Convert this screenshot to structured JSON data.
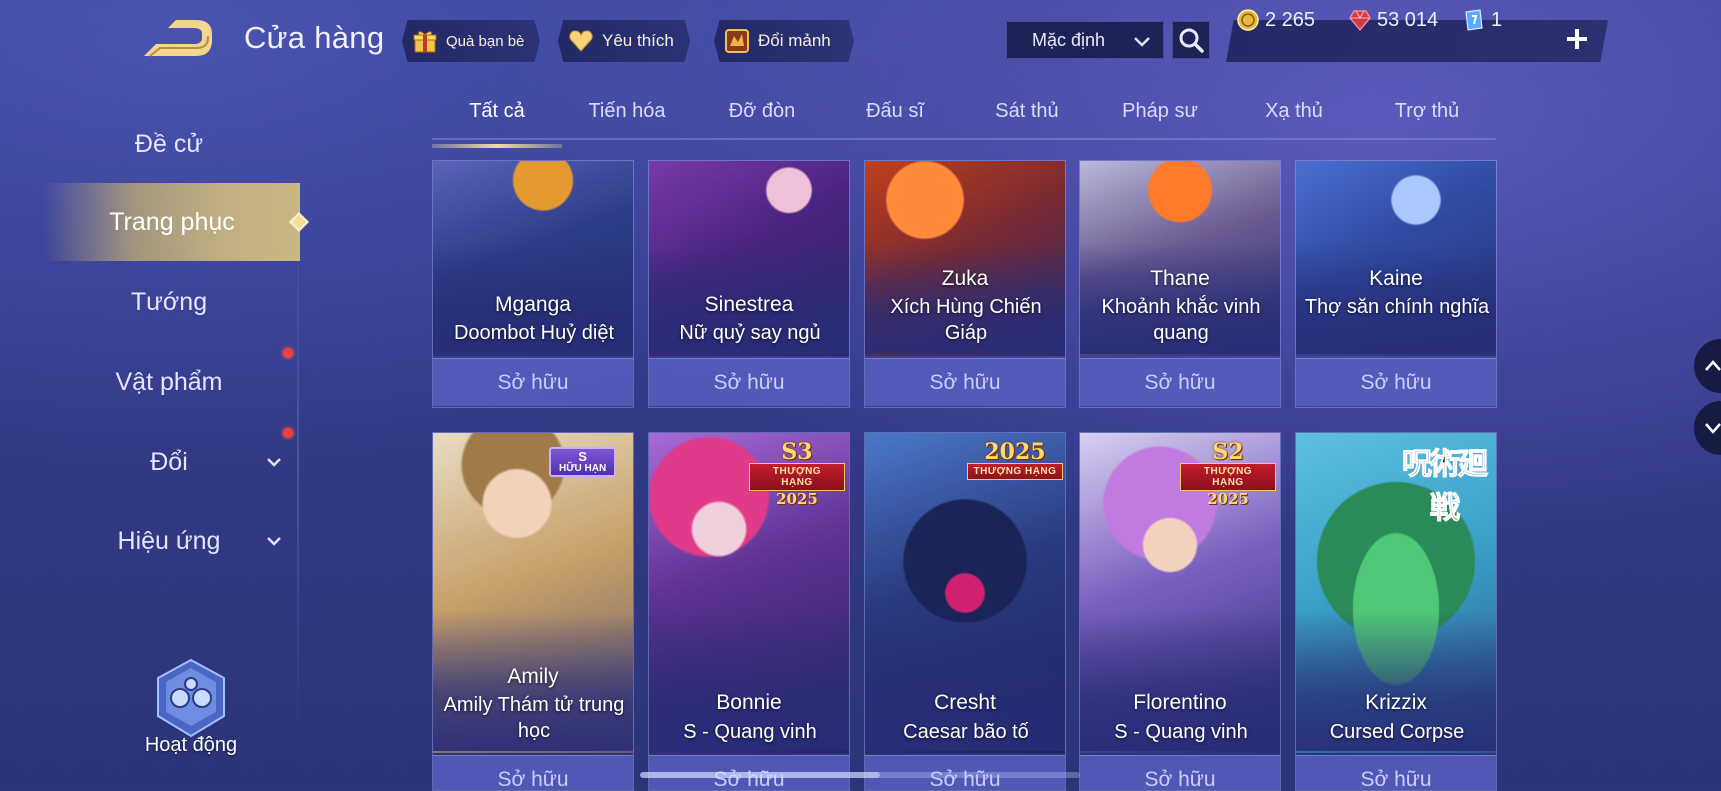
{
  "header": {
    "title": "Cửa hàng",
    "gift_label": "Quà bạn bè",
    "favorite_label": "Yêu thích",
    "shard_label": "Đổi mảnh",
    "sort_value": "Mặc định"
  },
  "currency": {
    "gold": "2 265",
    "ruby": "53 014",
    "voucher": "1"
  },
  "sidebar": {
    "items": [
      {
        "label": "Đề cử"
      },
      {
        "label": "Trang phục"
      },
      {
        "label": "Tướng"
      },
      {
        "label": "Vật phẩm"
      },
      {
        "label": "Đổi"
      },
      {
        "label": "Hiệu ứng"
      }
    ],
    "activity_label": "Hoạt động"
  },
  "tabs": [
    "Tất cả",
    "Tiến hóa",
    "Đỡ đòn",
    "Đấu sĩ",
    "Sát thủ",
    "Pháp sư",
    "Xạ thủ",
    "Trợ thủ"
  ],
  "owned_label": "Sở hữu",
  "badges": {
    "limited_top": "S",
    "limited_bottom": "HỮU HẠN",
    "rank_middle": "THƯỢNG HẠNG",
    "s3": "S3",
    "s2": "S2",
    "year": "2025",
    "jp": "呪術廻戦"
  },
  "row1": [
    {
      "hero": "Mganga",
      "skin": "Doombot Huỷ diệt"
    },
    {
      "hero": "Sinestrea",
      "skin": "Nữ quỷ say ngủ"
    },
    {
      "hero": "Zuka",
      "skin": "Xích Hùng Chiến Giáp"
    },
    {
      "hero": "Thane",
      "skin": "Khoảnh khắc vinh quang"
    },
    {
      "hero": "Kaine",
      "skin": "Thợ săn chính nghĩa"
    }
  ],
  "row2": [
    {
      "hero": "Amily",
      "skin": "Amily Thám tử trung học"
    },
    {
      "hero": "Bonnie",
      "skin": "S - Quang vinh"
    },
    {
      "hero": "Cresht",
      "skin": "Caesar bão tố"
    },
    {
      "hero": "Florentino",
      "skin": "S - Quang vinh"
    },
    {
      "hero": "Krizzix",
      "skin": "Cursed Corpse"
    }
  ],
  "colors": {
    "accent_gold": "#f2dca0",
    "owned_bg": "#585ebe",
    "notification": "#ff3b3b"
  },
  "icons": [
    "back-icon",
    "gift-icon",
    "heart-icon",
    "shard-chest-icon",
    "chevron-down-icon",
    "search-icon",
    "gold-coin-icon",
    "ruby-icon",
    "voucher-icon",
    "plus-icon",
    "activity-icon",
    "chevron-up-icon"
  ]
}
